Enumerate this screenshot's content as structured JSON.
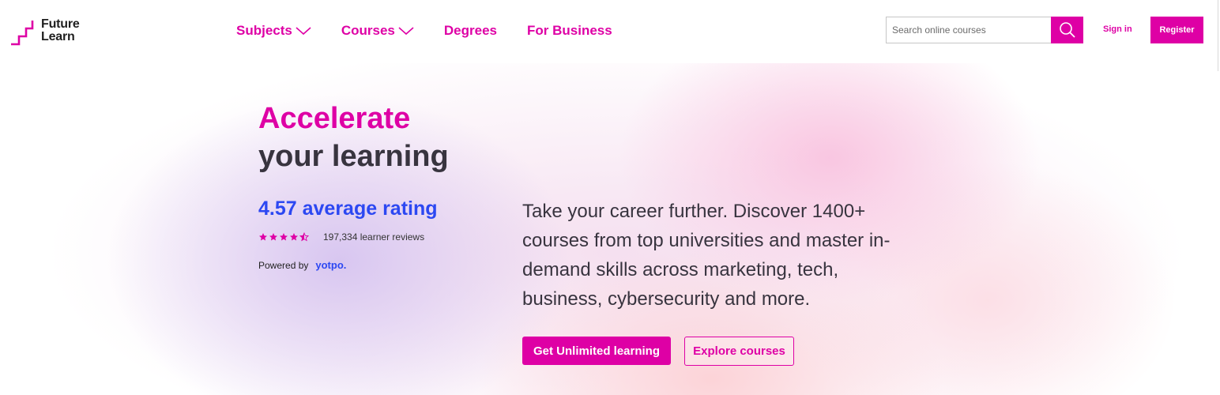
{
  "brand": {
    "logo_line1": "Future",
    "logo_line2": "Learn",
    "accent_color": "#de00a5",
    "rating_color": "#2c48f2",
    "text_color": "#38343f"
  },
  "nav": {
    "items": [
      {
        "label": "Subjects",
        "has_dropdown": true
      },
      {
        "label": "Courses",
        "has_dropdown": true
      },
      {
        "label": "Degrees",
        "has_dropdown": false
      },
      {
        "label": "For Business",
        "has_dropdown": false
      }
    ]
  },
  "search": {
    "placeholder": "Search online courses",
    "value": "",
    "icon": "search-icon"
  },
  "account": {
    "signin_label": "Sign in",
    "register_label": "Register"
  },
  "hero": {
    "headline_line1": "Accelerate",
    "headline_line2": "your learning",
    "rating_text": "4.57 average rating",
    "rating_value": 4.57,
    "rating_max": 5,
    "reviews_text": "197,334 learner reviews",
    "powered_by_label": "Powered by",
    "powered_by_brand": "yotpo.",
    "description": "Take your career further. Discover 1400+ courses from top universities and master in-demand skills across marketing, tech, business, cybersecurity and more.",
    "primary_cta": "Get Unlimited learning",
    "secondary_cta": "Explore courses"
  }
}
